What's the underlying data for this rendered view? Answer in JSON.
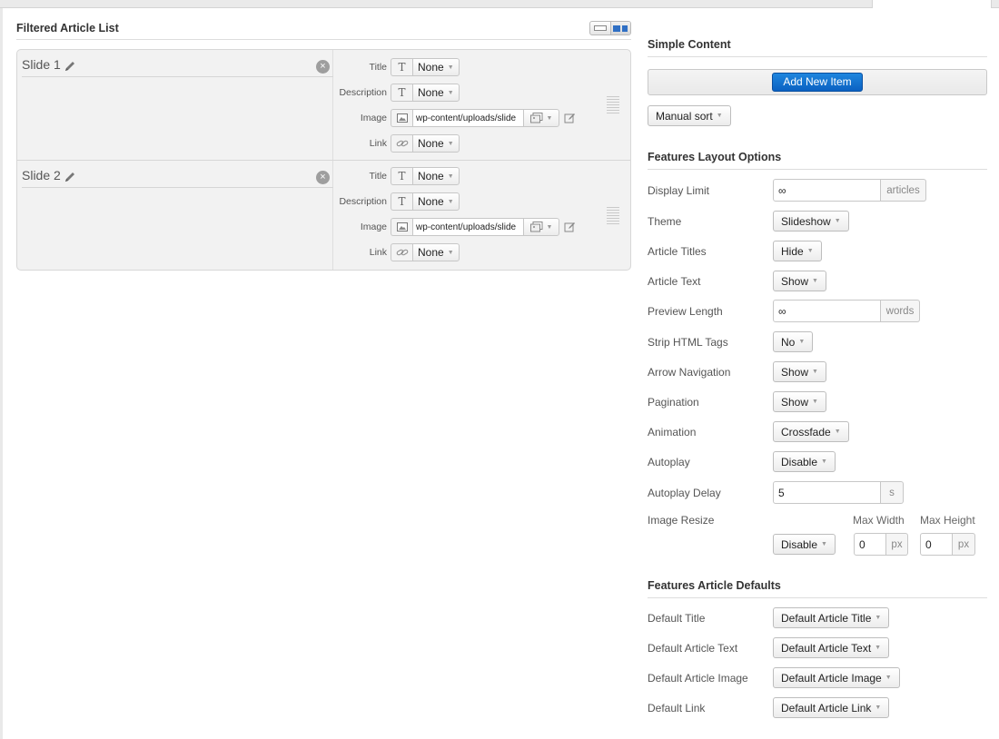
{
  "left": {
    "title": "Filtered Article List",
    "slides": [
      {
        "title": "Slide 1",
        "fields": {
          "title_label": "Title",
          "title_value": "None",
          "description_label": "Description",
          "description_value": "None",
          "image_label": "Image",
          "image_value": "wp-content/uploads/slide",
          "link_label": "Link",
          "link_value": "None"
        }
      },
      {
        "title": "Slide 2",
        "fields": {
          "title_label": "Title",
          "title_value": "None",
          "description_label": "Description",
          "description_value": "None",
          "image_label": "Image",
          "image_value": "wp-content/uploads/slide",
          "link_label": "Link",
          "link_value": "None"
        }
      }
    ],
    "icons": {
      "text": "T"
    }
  },
  "right": {
    "simple_content": {
      "title": "Simple Content",
      "add_button": "Add New Item",
      "sort_button": "Manual sort"
    },
    "layout": {
      "title": "Features Layout Options",
      "display_limit": {
        "label": "Display Limit",
        "value": "∞",
        "suffix": "articles"
      },
      "theme": {
        "label": "Theme",
        "value": "Slideshow"
      },
      "article_titles": {
        "label": "Article Titles",
        "value": "Hide"
      },
      "article_text": {
        "label": "Article Text",
        "value": "Show"
      },
      "preview_length": {
        "label": "Preview Length",
        "value": "∞",
        "suffix": "words"
      },
      "strip_html": {
        "label": "Strip HTML Tags",
        "value": "No"
      },
      "arrow_navigation": {
        "label": "Arrow Navigation",
        "value": "Show"
      },
      "pagination": {
        "label": "Pagination",
        "value": "Show"
      },
      "animation": {
        "label": "Animation",
        "value": "Crossfade"
      },
      "autoplay": {
        "label": "Autoplay",
        "value": "Disable"
      },
      "autoplay_delay": {
        "label": "Autoplay Delay",
        "value": "5",
        "suffix": "s"
      },
      "image_resize": {
        "label": "Image Resize",
        "value": "Disable",
        "max_width_label": "Max Width",
        "max_width": "0",
        "max_height_label": "Max Height",
        "max_height": "0",
        "unit": "px"
      }
    },
    "defaults": {
      "title": "Features Article Defaults",
      "default_title": {
        "label": "Default Title",
        "value": "Default Article Title"
      },
      "default_text": {
        "label": "Default Article Text",
        "value": "Default Article Text"
      },
      "default_image": {
        "label": "Default Article Image",
        "value": "Default Article Image"
      },
      "default_link": {
        "label": "Default Link",
        "value": "Default Article Link"
      }
    }
  },
  "colors": {
    "primary_button": "#0b61c2",
    "panel_bg": "#f2f2f2",
    "toggle_active": "#2f6fc4"
  }
}
